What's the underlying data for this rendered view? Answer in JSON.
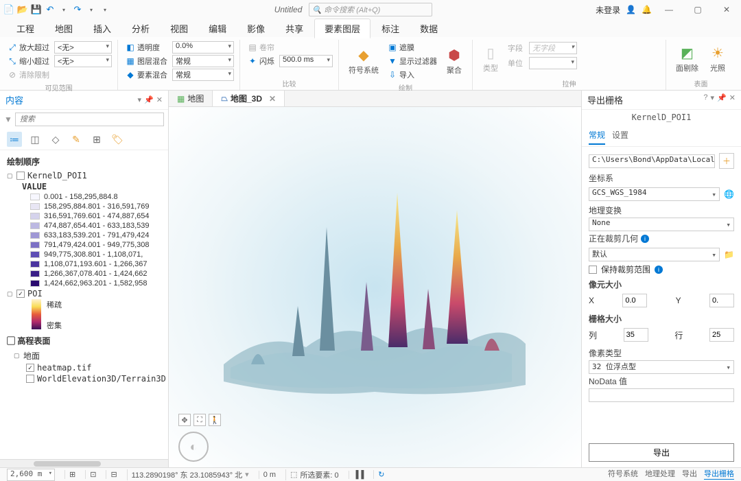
{
  "titlebar": {
    "title": "Untitled",
    "search_placeholder": "命令搜索 (Alt+Q)",
    "login": "未登录"
  },
  "menu": [
    "工程",
    "地图",
    "插入",
    "分析",
    "视图",
    "编辑",
    "影像",
    "共享",
    "要素图层",
    "标注",
    "数据"
  ],
  "menu_active_index": 8,
  "ribbon": {
    "g1": {
      "zoom_in": "放大超过",
      "zoom_out": "缩小超过",
      "clear": "清除限制",
      "sel1": "<无>",
      "sel2": "<无>",
      "label": "可见范围"
    },
    "g2": {
      "opacity": "透明度",
      "opacity_val": "0.0%",
      "layer_blend": "图层混合",
      "layer_blend_val": "常规",
      "feature_blend": "要素混合",
      "feature_blend_val": "常规"
    },
    "g3": {
      "swipe": "卷帘",
      "flash": "闪烁",
      "flash_val": "500.0 ms",
      "label": "比较"
    },
    "g4": {
      "symbol": "符号系统",
      "label": "绘制"
    },
    "g5": {
      "mask": "遮膜",
      "filter": "显示过滤器",
      "import": "导入"
    },
    "g6": {
      "aggregate": "聚合"
    },
    "g7": {
      "type": "类型",
      "field": "字段",
      "field_val": "无字段",
      "unit": "单位",
      "label": "拉伸"
    },
    "g8": {
      "face_cull": "面剔除",
      "lighting": "光照",
      "label": "表面"
    }
  },
  "contents": {
    "title": "内容",
    "search": "搜索",
    "section": "绘制顺序",
    "layer1": "KernelD_POI1",
    "value_label": "VALUE",
    "legend": [
      {
        "c": "#f7f7ff",
        "t": "0.001 - 158,295,884.8"
      },
      {
        "c": "#e8e6f4",
        "t": "158,295,884.801 - 316,591,769"
      },
      {
        "c": "#d5d3ec",
        "t": "316,591,769.601 - 474,887,654"
      },
      {
        "c": "#bcb8e2",
        "t": "474,887,654.401 - 633,183,539"
      },
      {
        "c": "#9f98d5",
        "t": "633,183,539.201 - 791,479,424"
      },
      {
        "c": "#7c71c5",
        "t": "791,479,424.001 - 949,775,308"
      },
      {
        "c": "#5e4eb5",
        "t": "949,775,308.801 - 1,108,071,"
      },
      {
        "c": "#4a349f",
        "t": "1,108,071,193.601 - 1,266,367"
      },
      {
        "c": "#3a1f87",
        "t": "1,266,367,078.401 - 1,424,662"
      },
      {
        "c": "#2a0a6e",
        "t": "1,424,662,963.201 - 1,582,958"
      }
    ],
    "poi": "POI",
    "poi_sparse": "稀疏",
    "poi_dense": "密集",
    "surface_section": "高程表面",
    "ground": "地面",
    "heatmap": "heatmap.tif",
    "world": "WorldElevation3D/Terrain3D"
  },
  "tabs": {
    "map2d": "地图",
    "map3d": "地图_3D"
  },
  "export": {
    "title": "导出栅格",
    "subtitle": "KernelD_POI1",
    "tab_general": "常规",
    "tab_settings": "设置",
    "path": "C:\\Users\\Bond\\AppData\\Local\\Temp",
    "crs_label": "坐标系",
    "crs_val": "GCS_WGS_1984",
    "geo_trans_label": "地理变换",
    "geo_trans_val": "None",
    "clip_label": "正在裁剪几何",
    "clip_val": "默认",
    "keep_clip": "保持裁剪范围",
    "cell_size": "像元大小",
    "x": "X",
    "y": "Y",
    "xval": "0.0",
    "yval": "0.",
    "raster_size": "栅格大小",
    "cols": "列",
    "rows": "行",
    "colsval": "35",
    "rowsval": "25",
    "pixel_type": "像素类型",
    "pixel_type_val": "32 位浮点型",
    "nodata": "NoData 值",
    "export_btn": "导出"
  },
  "status": {
    "scale": "2,600 m",
    "coord": "113.2890198° 东 23.1085943° 北",
    "elev": "0 m",
    "selected": "所选要素: 0",
    "bottom_tabs": [
      "符号系统",
      "地理处理",
      "导出",
      "导出栅格"
    ]
  }
}
